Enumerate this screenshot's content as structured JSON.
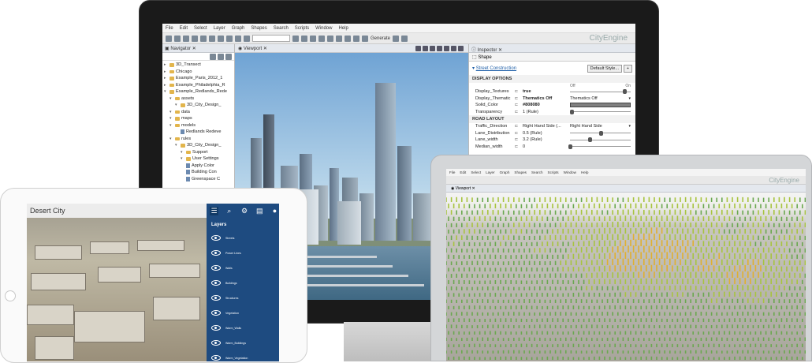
{
  "monitor": {
    "menu": [
      "File",
      "Edit",
      "Select",
      "Layer",
      "Graph",
      "Shapes",
      "Search",
      "Scripts",
      "Window",
      "Help"
    ],
    "toolbar": {
      "generate_label": "Generate",
      "brand": "CityEngine"
    },
    "navigator": {
      "title": "Navigator",
      "tree": [
        {
          "label": "3D_Transect",
          "level": 0,
          "kind": "folder"
        },
        {
          "label": "Chicago",
          "level": 0,
          "kind": "folder"
        },
        {
          "label": "Example_Paris_2012_1",
          "level": 0,
          "kind": "folder"
        },
        {
          "label": "Example_Philadelphia_R",
          "level": 0,
          "kind": "folder"
        },
        {
          "label": "Example_Redlands_Rede",
          "level": 0,
          "kind": "folder"
        },
        {
          "label": "assets",
          "level": 1,
          "kind": "folder"
        },
        {
          "label": "3D_City_Design_",
          "level": 2,
          "kind": "folder"
        },
        {
          "label": "data",
          "level": 1,
          "kind": "folder"
        },
        {
          "label": "maps",
          "level": 1,
          "kind": "folder"
        },
        {
          "label": "models",
          "level": 1,
          "kind": "folder"
        },
        {
          "label": "Redlands Redeve",
          "level": 2,
          "kind": "file"
        },
        {
          "label": "rules",
          "level": 1,
          "kind": "folder"
        },
        {
          "label": "3D_City_Design_",
          "level": 2,
          "kind": "folder"
        },
        {
          "label": "Support",
          "level": 3,
          "kind": "folder"
        },
        {
          "label": "User Settings",
          "level": 3,
          "kind": "folder"
        },
        {
          "label": "Apply Color",
          "level": 3,
          "kind": "file"
        },
        {
          "label": "Building Con",
          "level": 3,
          "kind": "file"
        },
        {
          "label": "Greenspace C",
          "level": 3,
          "kind": "file"
        }
      ]
    },
    "viewport": {
      "title": "Viewport"
    },
    "inspector": {
      "title": "Inspector",
      "tab": "Shape",
      "rule_link": "Street Construction",
      "default_style_button": "Default Style...",
      "sections": [
        {
          "title": "DISPLAY OPTIONS",
          "rows": [
            {
              "key": "Display_Textures",
              "value": "true",
              "bold": true,
              "widget_off": "Off",
              "widget_on": "On",
              "slider": 0.9
            },
            {
              "key": "Display_Thematic",
              "value": "Thematics Off",
              "bold": true,
              "combo": "Thematics Off"
            },
            {
              "key": "Solid_Color",
              "value": "#808080",
              "bold": true,
              "color": "#808080"
            },
            {
              "key": "Transparency",
              "value": "1 (Rule)",
              "bold": false,
              "slider": 0.02
            }
          ]
        },
        {
          "title": "ROAD LAYOUT",
          "rows": [
            {
              "key": "Traffic_Direction",
              "value": "Right Hand Side (...",
              "bold": false,
              "combo": "Right Hand Side"
            },
            {
              "key": "Lane_Distribution",
              "value": "0.5 (Rule)",
              "bold": false,
              "slider": 0.5
            },
            {
              "key": "Lane_width",
              "value": "3.2 (Rule)",
              "bold": false,
              "slider": 0.32
            },
            {
              "key": "Median_width",
              "value": "0",
              "bold": false,
              "slider": 0.0
            }
          ]
        }
      ]
    }
  },
  "tablet": {
    "title": "Desert City",
    "panel_title": "Layers",
    "layers": [
      "Streets",
      "Power Lines",
      "Walls",
      "Buildings",
      "Structures",
      "Vegetation",
      "Warm_Walls",
      "Warm_Buildings",
      "Warm_Vegetation"
    ],
    "toolbar_icons": [
      "layers-icon",
      "search-icon",
      "gear-icon",
      "comment-icon",
      "info-icon"
    ]
  },
  "laptop": {
    "menu": [
      "File",
      "Edit",
      "Select",
      "Layer",
      "Graph",
      "Shapes",
      "Search",
      "Scripts",
      "Window",
      "Help"
    ],
    "brand": "CityEngine",
    "viewport_title": "Viewport"
  }
}
